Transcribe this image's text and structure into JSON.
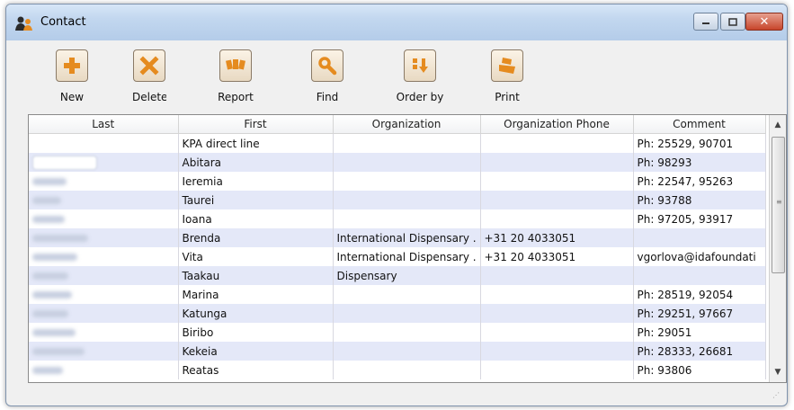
{
  "window": {
    "title": "Contact"
  },
  "toolbar": {
    "new_label": "New",
    "delete_label": "Delete",
    "report_label": "Report",
    "find_label": "Find",
    "order_by_label": "Order by",
    "print_label": "Print"
  },
  "table": {
    "columns": [
      "Last",
      "First",
      "Organization",
      "Organization Phone",
      "Comment"
    ],
    "rows": [
      {
        "last": "",
        "first": "KPA direct line",
        "org": "",
        "phone": "",
        "comment": "Ph: 25529, 90701"
      },
      {
        "last": "",
        "first": "Abitara",
        "org": "",
        "phone": "",
        "comment": "Ph: 98293"
      },
      {
        "last": "",
        "first": "Ieremia",
        "org": "",
        "phone": "",
        "comment": "Ph: 22547, 95263"
      },
      {
        "last": "",
        "first": "Taurei",
        "org": "",
        "phone": "",
        "comment": "Ph: 93788"
      },
      {
        "last": "",
        "first": "Ioana",
        "org": "",
        "phone": "",
        "comment": "Ph: 97205, 93917"
      },
      {
        "last": "",
        "first": "Brenda",
        "org": "International Dispensary .",
        "phone": "+31 20 4033051",
        "comment": ""
      },
      {
        "last": "",
        "first": "Vita",
        "org": "International Dispensary .",
        "phone": "+31 20 4033051",
        "comment": "vgorlova@idafoundati"
      },
      {
        "last": "",
        "first": "Taakau",
        "org": "Dispensary",
        "phone": "",
        "comment": ""
      },
      {
        "last": "",
        "first": "Marina",
        "org": "",
        "phone": "",
        "comment": "Ph: 28519, 92054"
      },
      {
        "last": "",
        "first": "Katunga",
        "org": "",
        "phone": "",
        "comment": "Ph: 29251, 97667"
      },
      {
        "last": "",
        "first": "Biribo",
        "org": "",
        "phone": "",
        "comment": "Ph: 29051"
      },
      {
        "last": "",
        "first": "Kekeia",
        "org": "",
        "phone": "",
        "comment": "Ph: 28333, 26681"
      },
      {
        "last": "",
        "first": "Reatas",
        "org": "",
        "phone": "",
        "comment": "Ph: 93806"
      }
    ]
  },
  "icons": {
    "title": "contact-people-icon",
    "new": "plus-icon",
    "delete": "x-icon",
    "report": "report-cards-icon",
    "find": "magnifier-icon",
    "order_by": "sort-arrows-icon",
    "print": "printer-icon"
  },
  "colors": {
    "alt_row": "#e4e8f8",
    "toolbar_icon_bg": "#e8d9c2",
    "icon_accent": "#e58b1f"
  }
}
